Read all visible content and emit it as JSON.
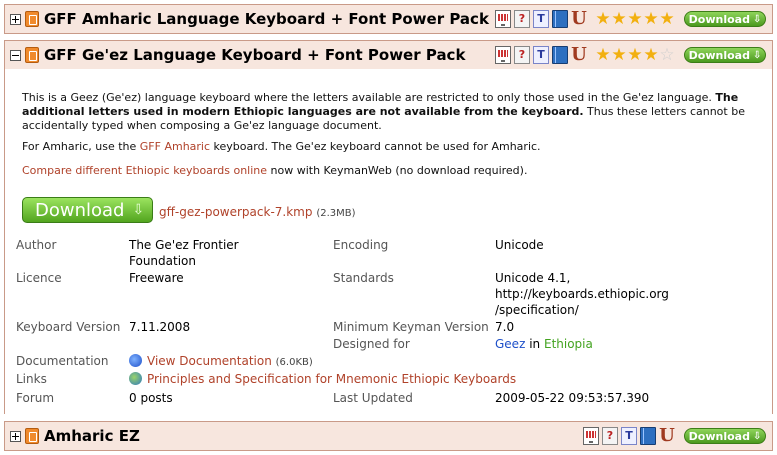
{
  "packages": [
    {
      "title": "GFF Amharic Language Keyboard + Font Power Pack",
      "expanded": false,
      "rating": 5,
      "download_label": "Download"
    },
    {
      "title": "GFF Ge'ez Language Keyboard + Font Power Pack",
      "expanded": true,
      "rating": 4,
      "download_label": "Download"
    },
    {
      "title": "Amharic EZ",
      "expanded": false,
      "rating": null,
      "download_label": "Download"
    }
  ],
  "icons": [
    "keyboard-icon",
    "help-icon",
    "font-icon",
    "book-icon",
    "unicode-icon"
  ],
  "detail": {
    "desc1_plain": "This is a Geez (Ge'ez) language keyboard where the letters available are restricted to only those used in the Ge'ez language.",
    "desc1_bold": "The additional letters used in modern Ethiopic languages are not available from the keyboard.",
    "desc1_tail": "Thus these letters cannot be accidentally typed when composing a Ge'ez language document.",
    "desc2_pre": "For Amharic, use the",
    "desc2_link": "GFF Amharic",
    "desc2_post": "keyboard. The Ge'ez keyboard cannot be used for Amharic.",
    "compare_link": "Compare different Ethiopic keyboards online",
    "compare_tail": "now with KeymanWeb (no download required).",
    "download_label": "Download",
    "file_name": "gff-gez-powerpack-7.kmp",
    "file_size": "(2.3MB)"
  },
  "fields": {
    "author_label": "Author",
    "author_value": "The Ge'ez Frontier Foundation",
    "encoding_label": "Encoding",
    "encoding_value": "Unicode",
    "licence_label": "Licence",
    "licence_value": "Freeware",
    "standards_label": "Standards",
    "standards_value_1": "Unicode 4.1,",
    "standards_value_2": "http://keyboards.ethiopic.org",
    "standards_value_3": "/specification/",
    "version_label": "Keyboard Version",
    "version_value": "7.11.2008",
    "min_keyman_label": "Minimum Keyman Version",
    "min_keyman_value": "7.0",
    "designed_label": "Designed for",
    "designed_lang": "Geez",
    "designed_in": "in",
    "designed_country": "Ethiopia",
    "documentation_label": "Documentation",
    "documentation_link": "View Documentation",
    "documentation_size": "(6.0KB)",
    "links_label": "Links",
    "links_link": "Principles and Specification for Mnemonic Ethiopic Keyboards",
    "forum_label": "Forum",
    "forum_link": "0 posts",
    "updated_label": "Last Updated",
    "updated_value": "2009-05-22 09:53:57.390"
  }
}
